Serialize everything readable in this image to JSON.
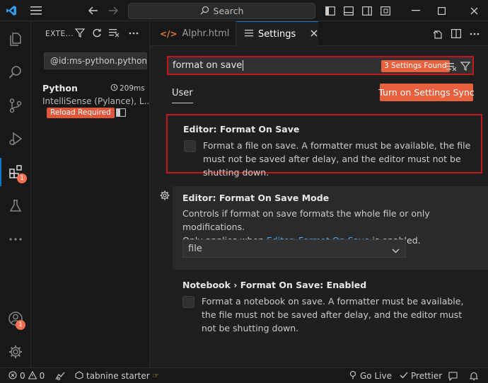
{
  "titlebar": {
    "search_placeholder": "Search"
  },
  "activitybar": {
    "extensions_badge": "1",
    "accounts_badge": "1"
  },
  "sidebar": {
    "title": "EXTE...",
    "search_value": "@id:ms-python.python",
    "extension": {
      "name": "Python",
      "time": "209ms",
      "description": "IntelliSense (Pylance), L...",
      "status": "Reload Required"
    }
  },
  "tabs": [
    {
      "label": "Alphr.html"
    },
    {
      "label": "Settings"
    }
  ],
  "settings": {
    "search_value": "format on save",
    "found_label": "3 Settings Found",
    "scope_tab": "User",
    "sync_button": "Turn on Settings Sync",
    "items": [
      {
        "title": "Editor: Format On Save",
        "description": "Format a file on save. A formatter must be available, the file must not be saved after delay, and the editor must not be shutting down."
      },
      {
        "title": "Editor: Format On Save Mode",
        "description_line1": "Controls if format on save formats the whole file or only modifications.",
        "description_pre": "Only applies when ",
        "description_link": "Editor: Format On Save",
        "description_post": " is enabled.",
        "selected_value": "file"
      },
      {
        "title": "Notebook › Format On Save: Enabled",
        "description": "Format a notebook on save. A formatter must be available, the file must not be saved after delay, and the editor must not be shutting down."
      }
    ]
  },
  "statusbar": {
    "errors": "0",
    "warnings": "0",
    "tabnine": "tabnine starter",
    "golive": "Go Live",
    "prettier": "Prettier"
  },
  "colors": {
    "accent": "#0078d4",
    "highlight_border": "#c4161c",
    "badge_orange": "#e8613e",
    "link": "#4daafc"
  }
}
